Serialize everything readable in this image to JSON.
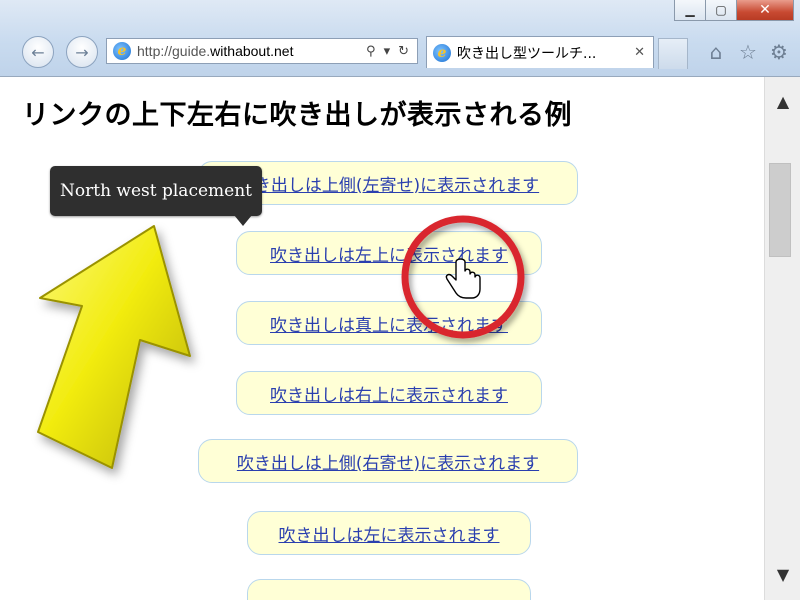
{
  "window": {
    "controls": {
      "minimize": "▁",
      "maximize": "▢",
      "close": "✕"
    }
  },
  "toolbar": {
    "back_icon": "←",
    "forward_icon": "→",
    "address": {
      "prefix": "http://guide.",
      "domain": "withabout.net",
      "search_icon": "⚲",
      "dropdown_icon": "▾",
      "refresh_icon": "↻"
    },
    "tab": {
      "title": "吹き出し型ツールチ...",
      "close": "✕"
    },
    "home_icon": "⌂",
    "favorites_icon": "☆",
    "settings_icon": "⚙"
  },
  "page": {
    "heading": "リンクの上下左右に吹き出しが表示される例",
    "links": [
      "吹き出しは上側(左寄せ)に表示されます",
      "吹き出しは左上に表示されます",
      "吹き出しは真上に表示されます",
      "吹き出しは右上に表示されます",
      "吹き出しは上側(右寄せ)に表示されます",
      "吹き出しは左に表示されます"
    ],
    "tooltip": "North west placement"
  },
  "scrollbar": {
    "up": "▲",
    "down": "▼"
  },
  "colors": {
    "accent_red": "#d9272e",
    "arrow_yellow": "#f4ef1a",
    "tooltip_bg": "#2f2f2f",
    "link_bg": "#ffffd6"
  }
}
